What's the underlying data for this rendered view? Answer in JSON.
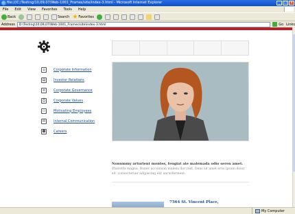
{
  "window": {
    "title": "file:///C:/Testing/10,09,07/Web-1001_Frames/site/index-3.html - Microsoft Internet Explorer",
    "controls": [
      "_",
      "□",
      "x"
    ]
  },
  "menubar": {
    "items": [
      "File",
      "Edit",
      "View",
      "Favorites",
      "Tools",
      "Help"
    ]
  },
  "toolbar": {
    "back_label": "Back",
    "search_label": "Search",
    "favorites_label": "Favorites"
  },
  "addressbar": {
    "label": "Address",
    "value": "D:\\Testing\\10,09,07\\Web-1001_Frames\\site\\index-3.html",
    "go_label": "Go",
    "links_label": "Links"
  },
  "page": {
    "accent_color": "#b5222a",
    "menu": [
      {
        "label": "Corporate Information",
        "icon": "building-icon"
      },
      {
        "label": "Investor Relations",
        "icon": "chart-icon"
      },
      {
        "label": "Corporate Governance",
        "icon": "document-icon"
      },
      {
        "label": "Corporate Values",
        "icon": "people-icon"
      },
      {
        "label": "Motivating Employees",
        "icon": "briefcase-icon"
      },
      {
        "label": "Internal Communication",
        "icon": "mail-icon"
      },
      {
        "label": "Careers",
        "icon": "user-icon"
      }
    ],
    "headline": "Nonummy arturient montes, feugiat ate malemada odio seren amet.",
    "body": "Pharetra magna. Donec accumsan malesu dor rest. Dens sit amet eros ipsum dolor sit ,consectetuer adipiscing elit aururferment.",
    "address_title": "7564 St. Vincent Place,"
  },
  "statusbar": {
    "left_text": "",
    "zone": "My Computer"
  }
}
